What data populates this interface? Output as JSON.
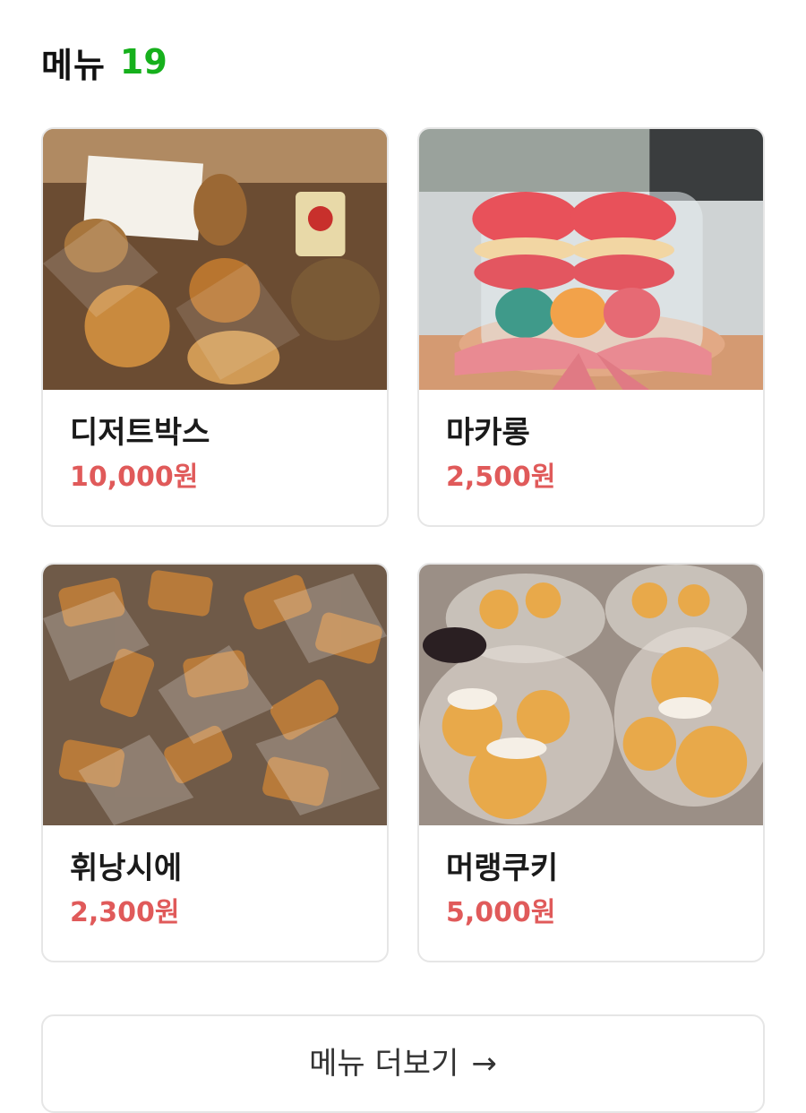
{
  "header": {
    "title": "메뉴",
    "count": "19"
  },
  "colors": {
    "count_accent": "#16b01c",
    "price_accent": "#e05a5a"
  },
  "menu_items": [
    {
      "name": "디저트박스",
      "price": "10,000원",
      "image": "dessert-box-photo"
    },
    {
      "name": "마카롱",
      "price": "2,500원",
      "image": "macaron-photo"
    },
    {
      "name": "휘낭시에",
      "price": "2,300원",
      "image": "financier-photo"
    },
    {
      "name": "머랭쿠키",
      "price": "5,000원",
      "image": "meringue-cookie-photo"
    }
  ],
  "more_button": {
    "label": "메뉴 더보기",
    "arrow_icon": "arrow-right-icon",
    "arrow_glyph": "→"
  }
}
